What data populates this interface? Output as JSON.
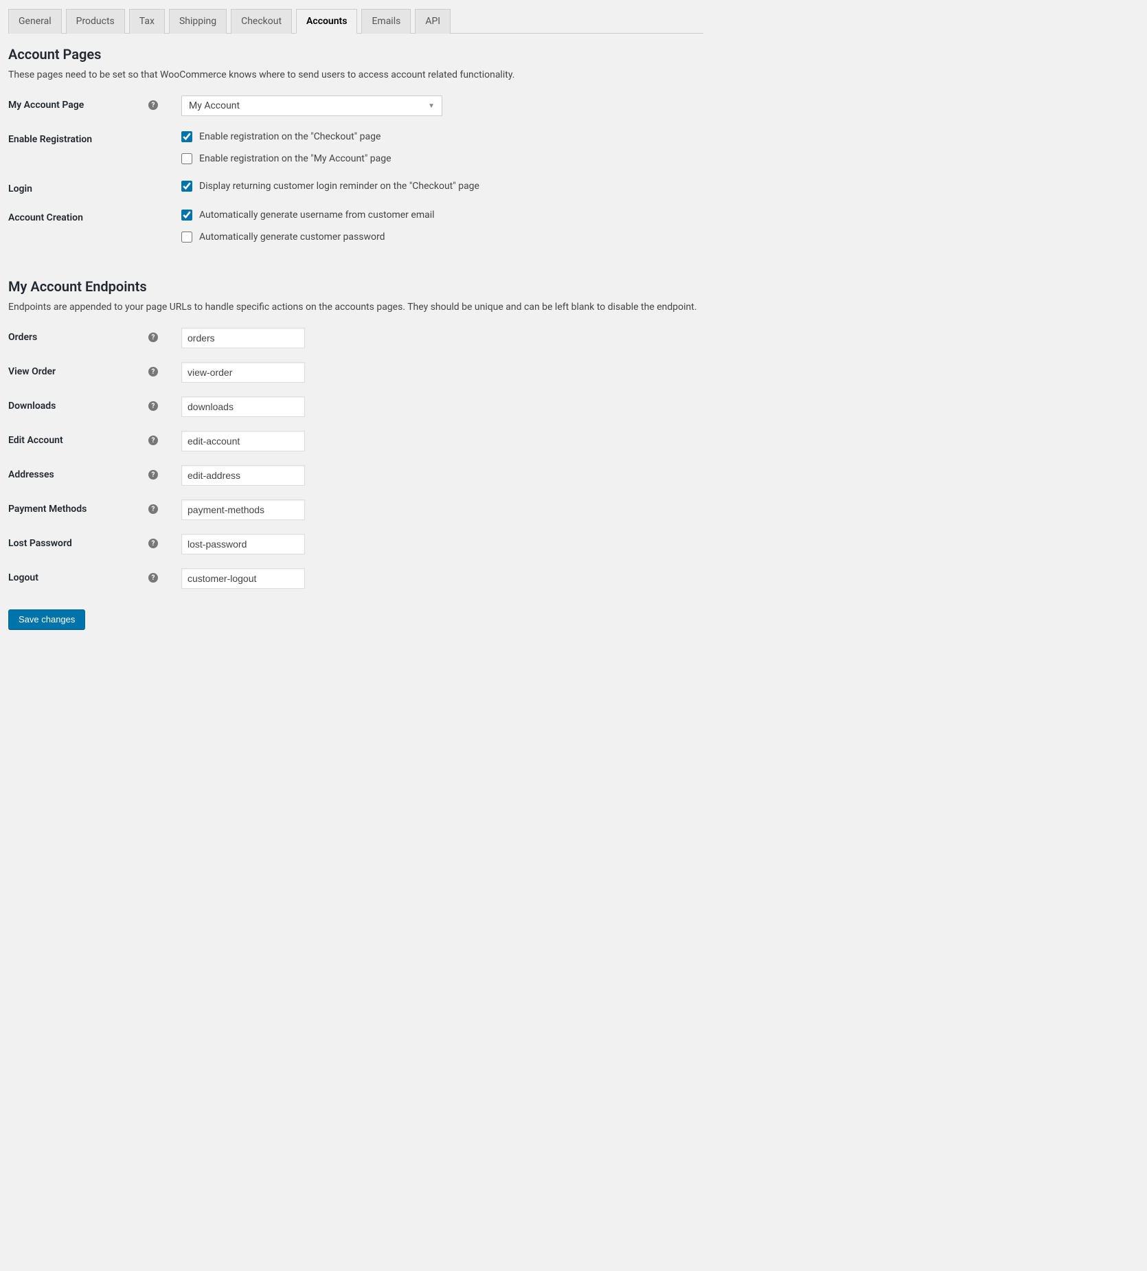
{
  "tabs": [
    {
      "label": "General",
      "active": false
    },
    {
      "label": "Products",
      "active": false
    },
    {
      "label": "Tax",
      "active": false
    },
    {
      "label": "Shipping",
      "active": false
    },
    {
      "label": "Checkout",
      "active": false
    },
    {
      "label": "Accounts",
      "active": true
    },
    {
      "label": "Emails",
      "active": false
    },
    {
      "label": "API",
      "active": false
    }
  ],
  "section1": {
    "title": "Account Pages",
    "desc": "These pages need to be set so that WooCommerce knows where to send users to access account related functionality."
  },
  "fields": {
    "my_account_page_label": "My Account Page",
    "my_account_page_value": "My Account",
    "enable_registration_label": "Enable Registration",
    "reg_checkout": {
      "label": "Enable registration on the \"Checkout\" page",
      "checked": true
    },
    "reg_myaccount": {
      "label": "Enable registration on the \"My Account\" page",
      "checked": false
    },
    "login_label": "Login",
    "login_reminder": {
      "label": "Display returning customer login reminder on the \"Checkout\" page",
      "checked": true
    },
    "account_creation_label": "Account Creation",
    "auto_username": {
      "label": "Automatically generate username from customer email",
      "checked": true
    },
    "auto_password": {
      "label": "Automatically generate customer password",
      "checked": false
    }
  },
  "section2": {
    "title": "My Account Endpoints",
    "desc": "Endpoints are appended to your page URLs to handle specific actions on the accounts pages. They should be unique and can be left blank to disable the endpoint."
  },
  "endpoints": {
    "orders": {
      "label": "Orders",
      "value": "orders"
    },
    "view_order": {
      "label": "View Order",
      "value": "view-order"
    },
    "downloads": {
      "label": "Downloads",
      "value": "downloads"
    },
    "edit_account": {
      "label": "Edit Account",
      "value": "edit-account"
    },
    "addresses": {
      "label": "Addresses",
      "value": "edit-address"
    },
    "payment_methods": {
      "label": "Payment Methods",
      "value": "payment-methods"
    },
    "lost_password": {
      "label": "Lost Password",
      "value": "lost-password"
    },
    "logout": {
      "label": "Logout",
      "value": "customer-logout"
    }
  },
  "save_button": "Save changes"
}
